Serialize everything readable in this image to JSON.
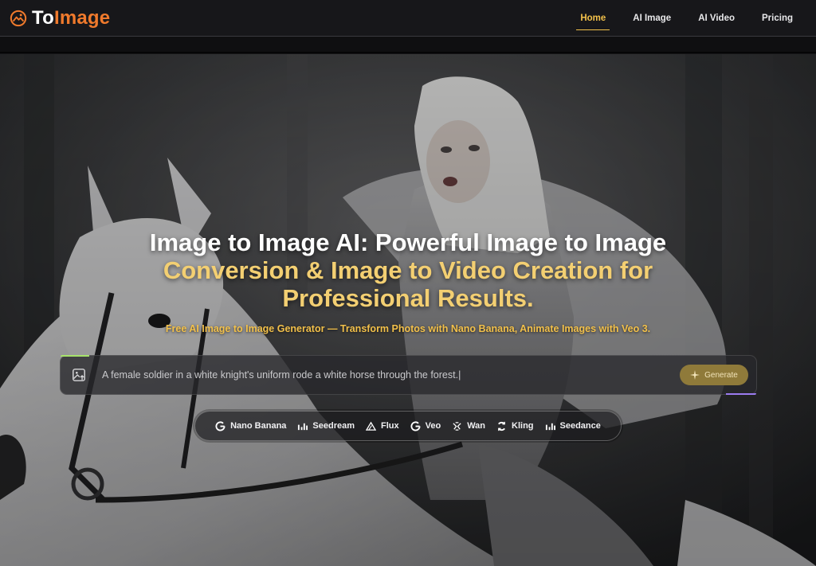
{
  "brand": {
    "to": "To",
    "image": "Image"
  },
  "nav": {
    "items": [
      {
        "label": "Home",
        "active": true
      },
      {
        "label": "AI Image",
        "active": false
      },
      {
        "label": "AI Video",
        "active": false
      },
      {
        "label": "Pricing",
        "active": false
      }
    ]
  },
  "hero": {
    "title_line1": "Image to Image AI: Powerful Image to Image",
    "title_line2": "Conversion & Image to Video Creation for",
    "title_line3": "Professional Results.",
    "subtitle": "Free AI Image to Image Generator — Transform Photos with Nano Banana, Animate Images with Veo 3.",
    "prompt_text": "A female soldier in a white knight's uniform rode a white horse through the forest.|",
    "generate_label": "Generate"
  },
  "models": [
    {
      "label": "Nano Banana",
      "icon": "google-icon"
    },
    {
      "label": "Seedream",
      "icon": "bars-icon"
    },
    {
      "label": "Flux",
      "icon": "triangle-icon"
    },
    {
      "label": "Veo",
      "icon": "google-icon"
    },
    {
      "label": "Wan",
      "icon": "wan-icon"
    },
    {
      "label": "Kling",
      "icon": "kling-icon"
    },
    {
      "label": "Seedance",
      "icon": "bars-icon"
    }
  ],
  "colors": {
    "accent": "#f07a2c",
    "gold": "#f2c04a",
    "gold_light": "#f3cf72",
    "button": "#8f7a3a"
  }
}
